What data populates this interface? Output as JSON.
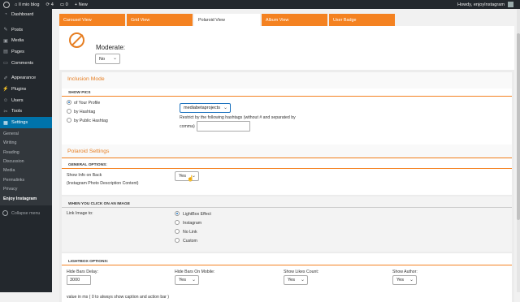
{
  "adminbar": {
    "site_name": "Il mio blog",
    "updates_count": "4",
    "comments_count": "0",
    "new_label": "New",
    "greeting": "Howdy, enjoyInstagram"
  },
  "sidebar": {
    "items": [
      {
        "label": "Dashboard",
        "icon": "dashboard-icon"
      },
      {
        "label": "Posts",
        "icon": "pin-icon"
      },
      {
        "label": "Media",
        "icon": "media-icon"
      },
      {
        "label": "Pages",
        "icon": "pages-icon"
      },
      {
        "label": "Comments",
        "icon": "comment-icon"
      },
      {
        "label": "Appearance",
        "icon": "brush-icon"
      },
      {
        "label": "Plugins",
        "icon": "plugin-icon"
      },
      {
        "label": "Users",
        "icon": "users-icon"
      },
      {
        "label": "Tools",
        "icon": "wrench-icon"
      },
      {
        "label": "Settings",
        "icon": "settings-icon"
      }
    ],
    "submenu": [
      "General",
      "Writing",
      "Reading",
      "Discussion",
      "Media",
      "Permalinks",
      "Privacy",
      "Enjoy Instagram"
    ],
    "collapse_label": "Collapse menu"
  },
  "tabs": [
    "Carousel View",
    "Grid View",
    "Polaroid View",
    "Album View",
    "User Badge"
  ],
  "active_tab": "Polaroid View",
  "moderate": {
    "label": "Moderate:",
    "value": "No"
  },
  "inclusion": {
    "title": "Inclusion Mode",
    "show_pics": "SHOW PICS",
    "options": [
      "of Your Profile",
      "by Hashtag",
      "by Public Hashtag"
    ],
    "selected": 0,
    "profile_select": "mediabetaprojects",
    "restrict_text": "Restrict by the following hashtags (without # and separated by",
    "comma_label": "comma)",
    "hashtag_value": ""
  },
  "polaroid": {
    "title": "Polaroid Settings",
    "general_options": "GENERAL OPTIONS:",
    "show_info_label": "Show Info on Back",
    "show_info_sub": "(Instagram Photo Description Content)",
    "show_info_value": "Yes",
    "click_header": "WHEN YOU CLICK ON AN IMAGE",
    "link_label": "Link Image to:",
    "link_options": [
      "LightBox Effect",
      "Instagram",
      "No Link",
      "Custom"
    ],
    "link_selected": 0,
    "lightbox_header": "LIGHTBOX OPTIONS:",
    "hide_bars_delay_label": "Hide Bars Delay:",
    "hide_bars_delay_value": "3000",
    "hide_bars_mobile_label": "Hide Bars On Mobile:",
    "hide_bars_mobile_value": "Yes",
    "show_likes_label": "Show Likes Count:",
    "show_likes_value": "Yes",
    "show_author_label": "Show Author:",
    "show_author_value": "Yes",
    "delay_note": "value in ms ( 0 to always show caption and action bar )"
  },
  "colors": {
    "accent": "#f48221",
    "admin_dark": "#23282d",
    "wp_blue": "#0073aa"
  }
}
